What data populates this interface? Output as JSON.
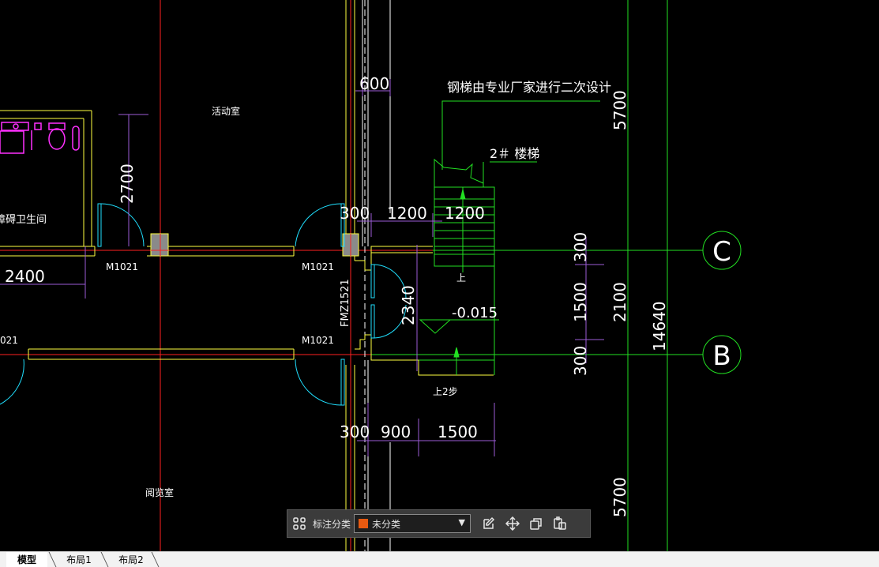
{
  "drawing": {
    "room_activity": "活动室",
    "room_reading": "阅览室",
    "room_toilet": "障碍卫生间",
    "stair_note": "钢梯由专业厂家进行二次设计",
    "stair_name": "2＃ 楼梯",
    "elevation": "-0.015",
    "up_label": "上",
    "up2_label": "上2步",
    "door_m1021": "M1021",
    "door_fmz": "FMZ1521",
    "door_partial": "021",
    "grid_c": "C",
    "grid_b": "B",
    "dims": {
      "d600": "600",
      "d2700": "2700",
      "d2400": "2400",
      "d300": "300",
      "d1200": "1200",
      "d2340": "2340",
      "d900": "900",
      "d1500": "1500",
      "d2100": "2100",
      "d14640": "14640",
      "d5700": "5700"
    }
  },
  "toolbar": {
    "category_label": "标注分类",
    "category_value": "未分类",
    "icons": [
      "grid-icon",
      "edit-icon",
      "move-icon",
      "copy-icon",
      "paste-icon"
    ]
  },
  "tabs": [
    "模型",
    "布局1",
    "布局2"
  ],
  "colors": {
    "background": "#000000",
    "axis_red": "#ff2020",
    "wall_yellow": "#ffff40",
    "stair_green": "#22e022",
    "dim_purple": "#9b5cd6",
    "door_cyan": "#20e0ff",
    "fixture_magenta": "#ff30ff",
    "swatch": "#e85a10"
  }
}
